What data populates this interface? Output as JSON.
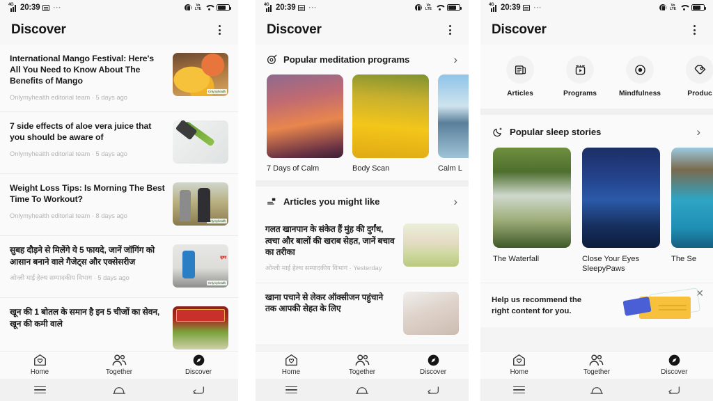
{
  "status_bar": {
    "network": "4G",
    "time": "20:39",
    "message_icon": "message-icon",
    "overflow": "···",
    "vibrate_icon": "vibrate-icon",
    "volte_top": "Vo",
    "volte_bottom": "LTE",
    "wifi_icon": "wifi-icon",
    "battery_icon": "battery-icon"
  },
  "app_bar": {
    "title": "Discover",
    "menu_icon": "kebab-menu-icon"
  },
  "bottom_nav": {
    "items": [
      {
        "label": "Home",
        "icon": "home-heart-icon",
        "active": false
      },
      {
        "label": "Together",
        "icon": "people-icon",
        "active": false
      },
      {
        "label": "Discover",
        "icon": "compass-icon",
        "active": true
      }
    ]
  },
  "system_bar": {
    "recents_icon": "recents-menu-icon",
    "home_icon": "home-icon",
    "back_icon": "back-icon"
  },
  "panel1": {
    "articles": [
      {
        "headline": "International Mango Festival: Here's All You Need to Know About The Benefits of Mango",
        "meta": "Onlymyhealth editorial team · 5 days ago",
        "watermark": "Onlymyhealth",
        "thumb": "mango-photo"
      },
      {
        "headline": "7 side effects of aloe vera juice that you should be aware of",
        "meta": "Onlymyhealth editorial team · 5 days ago",
        "watermark": "",
        "thumb": "aloe-vera-photo"
      },
      {
        "headline": "Weight Loss Tips: Is Morning The Best Time To Workout?",
        "meta": "Onlymyhealth editorial team · 8 days ago",
        "watermark": "Onlymyhealth",
        "thumb": "workout-photo"
      },
      {
        "headline": "सुबह दौड़ने से मिलेंगे ये 5 फायदे, जानें जॉगिंग को आसान बनाने वाले गैजेट्स और एक्सेसरीज",
        "meta": "ओन्ली माई हेल्थ सम्पादकीय विभाग · 5 days ago",
        "watermark": "Onlymyhealth",
        "thumb": "jogging-photo"
      },
      {
        "headline": "खून की 1 बोतल के समान है इन 5 चीजों का सेवन, खून की कमी वाले",
        "meta": "",
        "watermark": "",
        "thumb": "blood-food-photo"
      }
    ]
  },
  "panel2": {
    "meditation_section": {
      "icon": "target-meditation-icon",
      "title": "Popular meditation programs",
      "chevron": "›",
      "cards": [
        {
          "caption": "7 Days of Calm",
          "art": "sunset-mountains"
        },
        {
          "caption": "Body Scan",
          "art": "wheat-field"
        },
        {
          "caption": "Calm L",
          "art": "calm-lake"
        }
      ]
    },
    "articles_section": {
      "icon": "articles-list-icon",
      "title": "Articles you might like",
      "chevron": "›",
      "articles": [
        {
          "headline": "गलत खानपान के संकेत हैं मुंह की दुर्गंध, त्वचा और बालों की खराब सेहत, जानें बचाव का तरीका",
          "meta": "ओन्ली माई हेल्थ सम्पादकीय विभाग · Yesterday",
          "thumb": "woman-vegetables-photo"
        },
        {
          "headline": "खाना पचाने से लेकर ऑक्सीजन पहुंचाने तक आपकी सेहत के लिए",
          "meta": "",
          "thumb": "body-photo"
        }
      ]
    }
  },
  "panel3": {
    "categories": [
      {
        "label": "Articles",
        "icon": "articles-icon"
      },
      {
        "label": "Programs",
        "icon": "programs-play-icon"
      },
      {
        "label": "Mindfulness",
        "icon": "mindfulness-circle-icon"
      },
      {
        "label": "Produc",
        "icon": "products-tag-icon"
      }
    ],
    "sleep_section": {
      "icon": "moon-icon",
      "title": "Popular sleep stories",
      "chevron": "›",
      "cards": [
        {
          "caption": "The Waterfall",
          "art": "waterfall-photo"
        },
        {
          "caption": "Close Your Eyes SleepyPaws",
          "art": "night-sky-photo"
        },
        {
          "caption": "The Se",
          "art": "sea-cove-photo"
        }
      ]
    },
    "promo": {
      "line1": "Help us recommend the",
      "line2": "right content for you.",
      "close_icon": "close-icon",
      "illustration": "envelopes-illustration"
    }
  }
}
